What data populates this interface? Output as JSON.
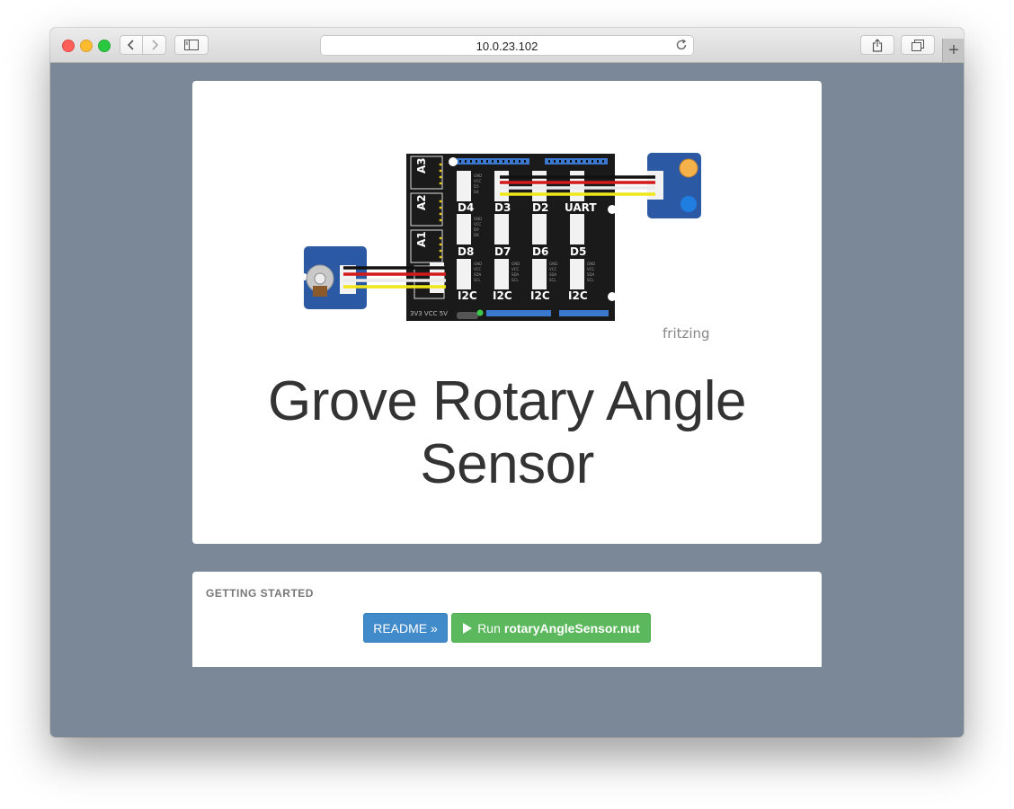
{
  "browser": {
    "url": "10.0.23.102"
  },
  "page": {
    "title": "Grove Rotary Angle Sensor",
    "diagram": {
      "shield_ports": [
        "A3",
        "A2",
        "A1",
        "D4",
        "D3",
        "D2",
        "UART",
        "D8",
        "D7",
        "D6",
        "D5",
        "I2C",
        "I2C",
        "I2C",
        "I2C"
      ],
      "pin_labels": [
        "GND",
        "VCC",
        "D5",
        "D4",
        "SDA",
        "SCL",
        "3V3",
        "VCC",
        "5V"
      ],
      "watermark": "fritzing"
    },
    "getting_started": {
      "heading": "GETTING STARTED",
      "readme_label": "README »",
      "run_prefix": "Run",
      "run_file": "rotaryAngleSensor.nut"
    }
  },
  "colors": {
    "window_bg": "#7a8898",
    "readme_button": "#428bca",
    "run_button": "#5cb85c",
    "title_text": "#333333"
  },
  "icons": [
    "chevron-left-icon",
    "chevron-right-icon",
    "sidebar-icon",
    "reload-icon",
    "share-icon",
    "tabs-icon",
    "plus-icon",
    "play-icon"
  ]
}
